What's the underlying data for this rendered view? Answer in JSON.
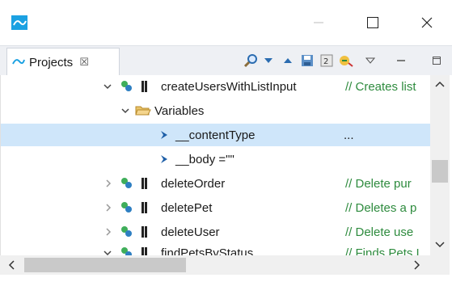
{
  "window": {
    "minimize_glyph": "—",
    "maximize_glyph": "☐",
    "close_glyph": "✕"
  },
  "view": {
    "tab_label": "Projects",
    "tab_close_glyph": "☒",
    "toolbar_icons": [
      "search-icon",
      "dropdown-arrow-icon",
      "collapse-up-icon",
      "save-icon",
      "refresh-icon",
      "run-icon",
      "view-menu-icon",
      "minimize-view-icon",
      "maximize-view-icon"
    ]
  },
  "tree": {
    "rows": [
      {
        "label": "createUsersWithListInput",
        "comment": "// Creates list",
        "expanded": true
      },
      {
        "label": "Variables",
        "expanded": true
      },
      {
        "label": "__contentType",
        "value": "..."
      },
      {
        "label": "__body =\"\""
      },
      {
        "label": "deleteOrder",
        "comment": "// Delete pur"
      },
      {
        "label": "deletePet",
        "comment": "// Deletes a p"
      },
      {
        "label": "deleteUser",
        "comment": "// Delete use"
      },
      {
        "label": "findPetsByStatus",
        "comment": "// Finds Pets I",
        "expanded": true
      }
    ]
  },
  "colors": {
    "selection": "#cfe6fa",
    "comment": "#2e8b3e",
    "accent": "#1ba1e2"
  }
}
